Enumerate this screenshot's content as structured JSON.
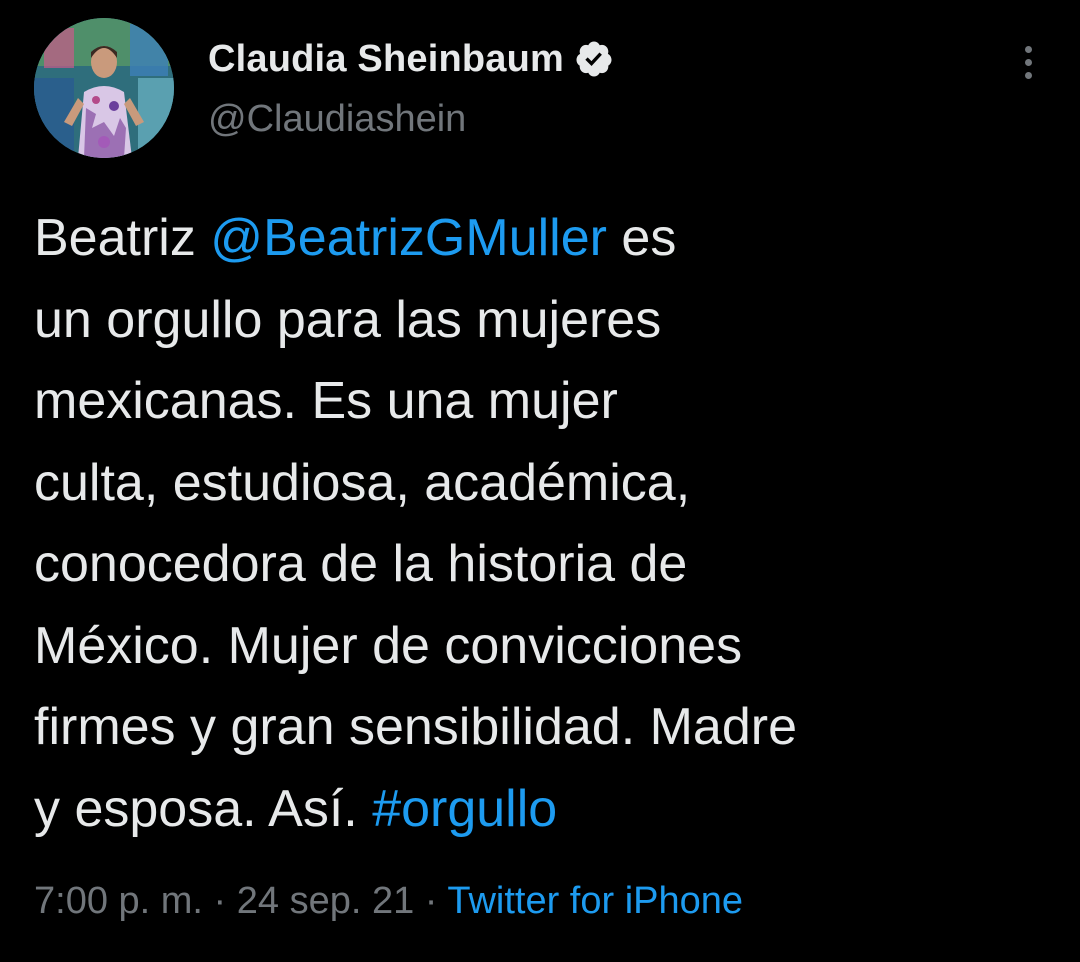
{
  "colors": {
    "background": "#000000",
    "text": "#e7e9ea",
    "secondary": "#71767b",
    "link": "#1d9bf0",
    "verified_badge": "#e7e9ea"
  },
  "author": {
    "display_name": "Claudia Sheinbaum",
    "handle": "@Claudiashein",
    "verified": true,
    "avatar_icon": "profile-photo"
  },
  "menu": {
    "icon": "more-vertical-icon"
  },
  "tweet": {
    "lines": [
      {
        "pre": "Beatriz ",
        "mention": "@BeatrizGMuller",
        "post": " es"
      },
      {
        "text": "un orgullo para las mujeres"
      },
      {
        "text": "mexicanas. Es una mujer"
      },
      {
        "text": "culta, estudiosa, académica,"
      },
      {
        "text": "conocedora de la historia de"
      },
      {
        "text": "México. Mujer de convicciones"
      },
      {
        "text": "firmes y gran sensibilidad. Madre"
      },
      {
        "pre": "y esposa. Así. ",
        "hashtag": "#orgullo"
      }
    ]
  },
  "meta": {
    "time": "7:00 p. m.",
    "separator": " · ",
    "date": "24 sep. 21",
    "source": "Twitter for iPhone"
  }
}
